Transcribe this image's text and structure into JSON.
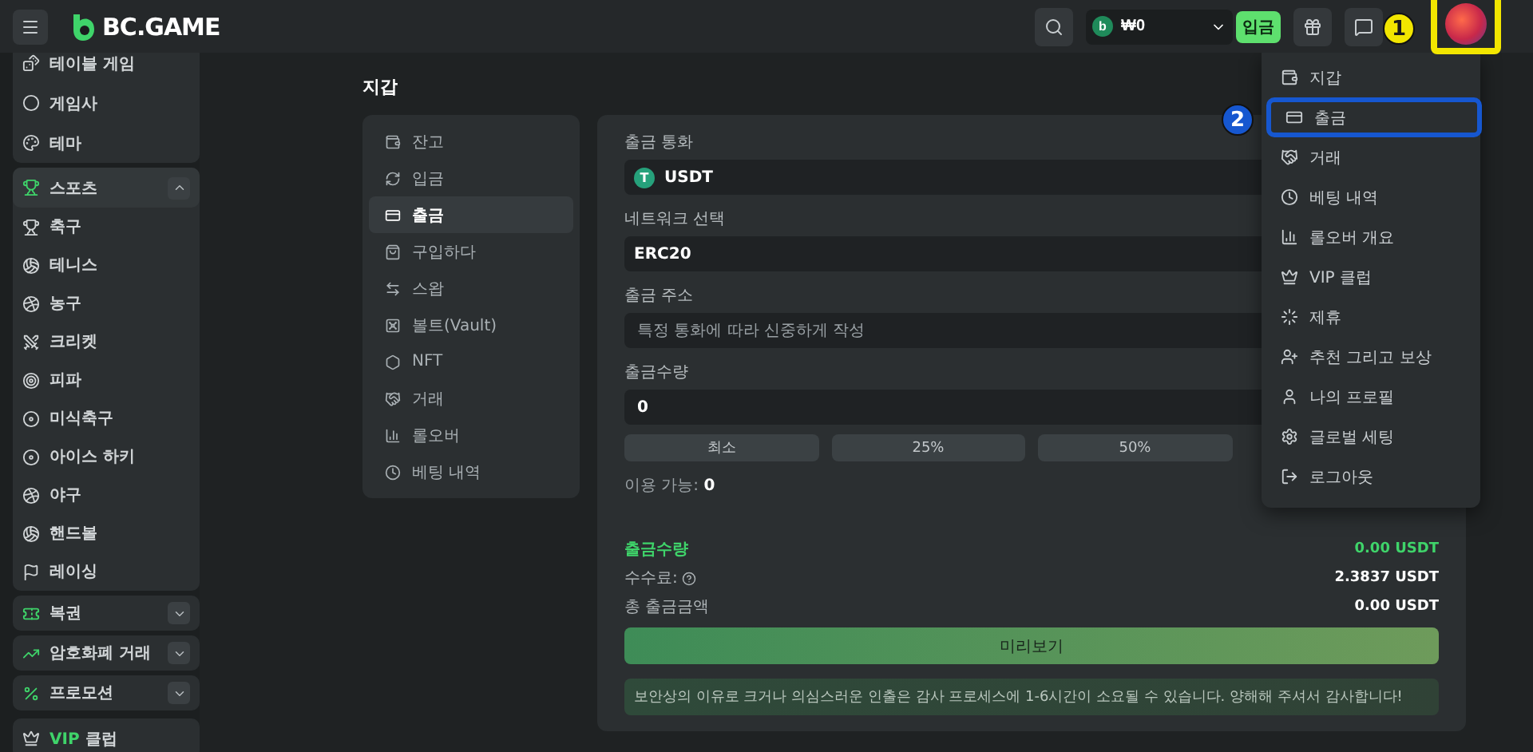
{
  "topbar": {
    "logo": "BC.GAME",
    "balance": {
      "badge": "b",
      "amount": "₩0"
    },
    "deposit_button": "입금"
  },
  "sidebar": {
    "groups": [
      {
        "kind": "plain",
        "items": [
          {
            "label": "테이블 게임"
          },
          {
            "label": "게임사"
          },
          {
            "label": "테마"
          }
        ]
      },
      {
        "kind": "section",
        "label": "스포츠",
        "expanded": true,
        "items": [
          {
            "label": "축구"
          },
          {
            "label": "테니스"
          },
          {
            "label": "농구"
          },
          {
            "label": "크리켓"
          },
          {
            "label": "피파"
          },
          {
            "label": "미식축구"
          },
          {
            "label": "아이스 하키"
          },
          {
            "label": "야구"
          },
          {
            "label": "핸드볼"
          },
          {
            "label": "레이싱"
          }
        ]
      },
      {
        "kind": "section",
        "label": "복권",
        "expanded": false
      },
      {
        "kind": "section",
        "label": "암호화폐 거래",
        "expanded": false
      },
      {
        "kind": "section",
        "label": "프로모션",
        "expanded": false
      },
      {
        "kind": "vip",
        "accent": "VIP",
        "label": "클럽"
      }
    ]
  },
  "page_title": "지갑",
  "wallet_nav": [
    {
      "label": "잔고",
      "selected": false
    },
    {
      "label": "입금",
      "selected": false
    },
    {
      "label": "출금",
      "selected": true
    },
    {
      "label": "구입하다",
      "selected": false
    },
    {
      "label": "스왑",
      "selected": false
    },
    {
      "label": "볼트(Vault)",
      "selected": false
    },
    {
      "label": "NFT",
      "selected": false
    },
    {
      "label": "거래",
      "selected": false
    },
    {
      "label": "롤오버",
      "selected": false
    },
    {
      "label": "베팅 내역",
      "selected": false
    }
  ],
  "form": {
    "currency": {
      "label": "출금 통화",
      "badge": "T",
      "value": "USDT"
    },
    "network": {
      "label": "네트워크 선택",
      "value": "ERC20"
    },
    "address": {
      "label": "출금 주소",
      "placeholder": "특정 통화에 따라 신중하게 작성"
    },
    "amount": {
      "label": "출금수량",
      "value": "0"
    },
    "quick_buttons": [
      "최소",
      "25%",
      "50%"
    ],
    "available": {
      "label": "이용 가능:",
      "value": "0"
    },
    "summary": [
      {
        "label": "출금수량",
        "value": "0.00 USDT",
        "highlight": true,
        "help": false
      },
      {
        "label": "수수료:",
        "value": "2.3837 USDT",
        "highlight": false,
        "help": true
      },
      {
        "label": "총 출금금액",
        "value": "0.00 USDT",
        "highlight": false,
        "help": false
      }
    ],
    "preview_button": "미리보기",
    "notice": "보안상의 이유로 크거나 의심스러운 인출은 감사 프로세스에 1-6시간이 소요될 수 있습니다. 양해해 주셔서 감사합니다!"
  },
  "user_menu": [
    {
      "label": "지갑",
      "marked": false
    },
    {
      "label": "출금",
      "marked": true
    },
    {
      "label": "거래",
      "marked": false
    },
    {
      "label": "베팅 내역",
      "marked": false
    },
    {
      "label": "롤오버 개요",
      "marked": false
    },
    {
      "label": "VIP 클럽",
      "marked": false
    },
    {
      "label": "제휴",
      "marked": false
    },
    {
      "label": "추천 그리고 보상",
      "marked": false
    },
    {
      "label": "나의 프로필",
      "marked": false
    },
    {
      "label": "글로벌 세팅",
      "marked": false
    },
    {
      "label": "로그아웃",
      "marked": false
    }
  ],
  "annotations": [
    {
      "kind": "avatar",
      "number": "1",
      "color": "#f2e600"
    },
    {
      "kind": "menu-item",
      "number": "2",
      "color": "#1657d0"
    }
  ]
}
